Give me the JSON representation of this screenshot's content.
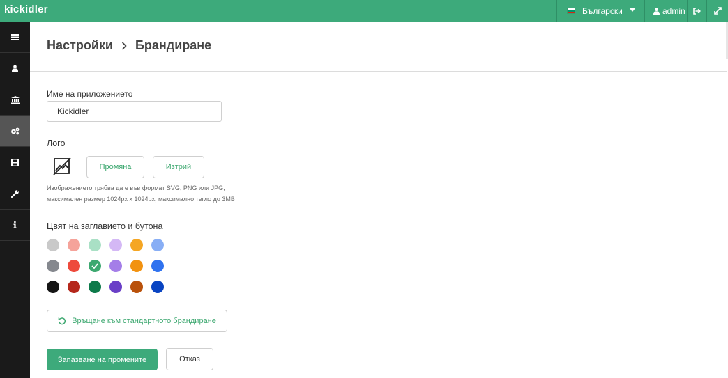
{
  "topbar": {
    "logo": "kickidler",
    "language": "Български",
    "user": "admin",
    "colors": {
      "bg": "#3daa7b"
    },
    "icons": {
      "flag": "bulgaria-flag-icon",
      "caret": "caret-down-icon",
      "user": "user-icon",
      "logout": "sign-out-icon",
      "expand": "expand-icon"
    }
  },
  "sidebar": {
    "items": [
      {
        "icon": "list-icon",
        "active": false
      },
      {
        "icon": "user-icon",
        "active": false
      },
      {
        "icon": "bank-icon",
        "active": false
      },
      {
        "icon": "cogs-icon",
        "active": true
      },
      {
        "icon": "save-icon",
        "active": false
      },
      {
        "icon": "wrench-icon",
        "active": false
      },
      {
        "icon": "info-icon",
        "active": false
      }
    ]
  },
  "breadcrumb": {
    "parent": "Настройки",
    "current": "Брандиране"
  },
  "form": {
    "app_name_label": "Име на приложението",
    "app_name_value": "Kickidler",
    "logo_label": "Лого",
    "change_button": "Промяна",
    "delete_button": "Изтрий",
    "logo_hint_1": "Изображението трябва да е във формат SVG, PNG или JPG,",
    "logo_hint_2": "максимален размер 1024px x 1024px, максимално тегло до 3MB",
    "color_label": "Цвят на заглавието и бутона",
    "colors": [
      [
        "#c9c9c9",
        "#f5a39a",
        "#a9e0c5",
        "#d4b8f5",
        "#f5a623",
        "#88aef5"
      ],
      [
        "#85888e",
        "#ee4a3c",
        "#3da870",
        "#a47ee8",
        "#f29210",
        "#2f72ef"
      ],
      [
        "#151515",
        "#b5271b",
        "#0d7a4a",
        "#6a3fc7",
        "#b9510b",
        "#0944c2"
      ]
    ],
    "selected_color": "#3da870",
    "reset_button": "Връщане към стандартното брандиране",
    "save_button": "Запазване на промените",
    "cancel_button": "Отказ"
  }
}
